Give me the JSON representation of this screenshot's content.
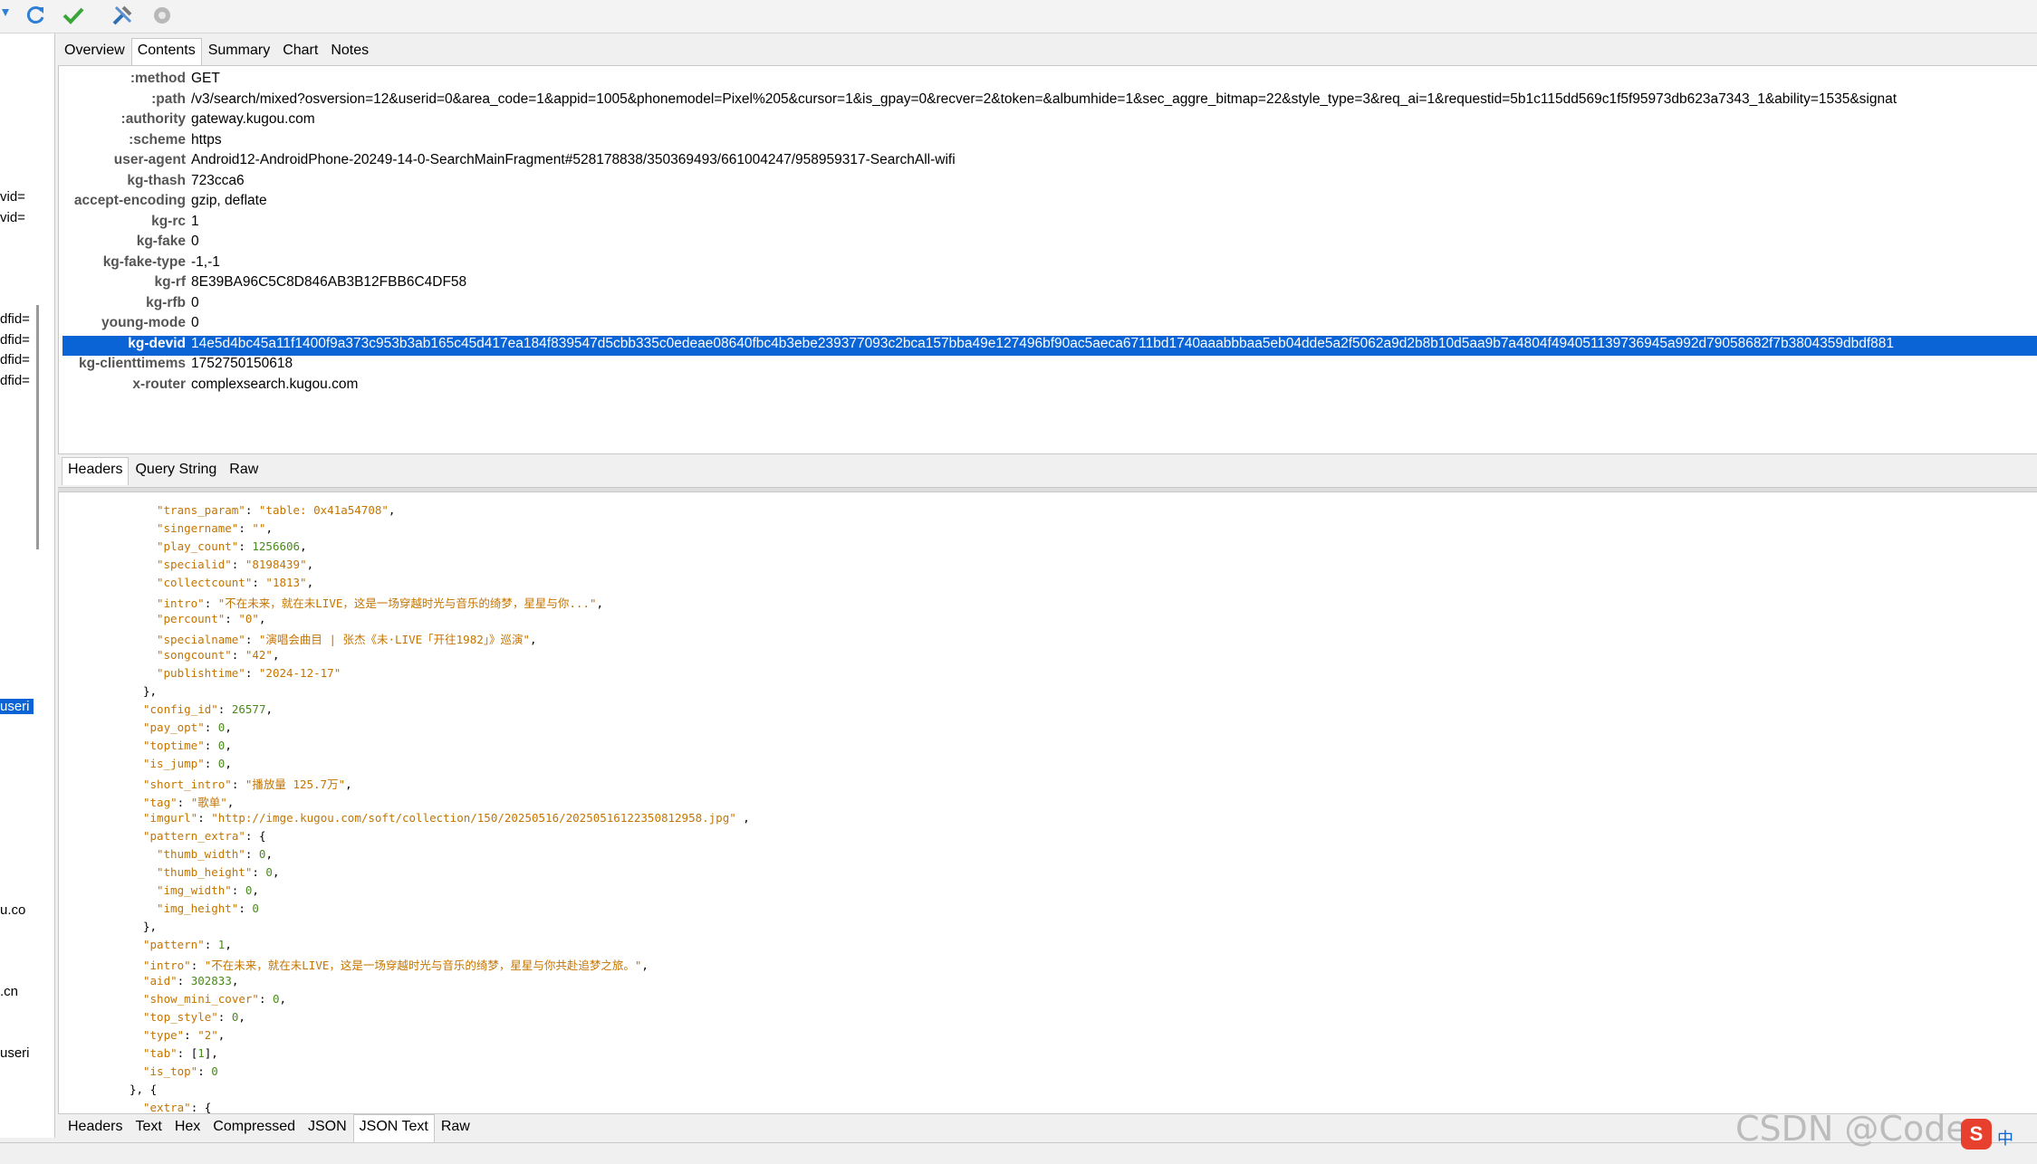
{
  "window": {
    "top_tabs": [
      "Overview",
      "Contents",
      "Summary",
      "Chart",
      "Notes"
    ],
    "active_top_tab": "Contents",
    "mid_tabs": [
      "Headers",
      "Query String",
      "Raw"
    ],
    "bottom_tabs": [
      "Headers",
      "Text",
      "Hex",
      "Compressed",
      "JSON",
      "JSON Text",
      "Raw"
    ]
  },
  "sidebar": {
    "fragments": [
      "vid=",
      "vid=",
      "dfid=",
      "dfid=",
      "dfid=",
      "dfid=",
      "useri",
      "u.co",
      ".cn",
      "useri"
    ]
  },
  "headers": [
    {
      "key": ":method",
      "value": "GET"
    },
    {
      "key": ":path",
      "value": "/v3/search/mixed?osversion=12&userid=0&area_code=1&appid=1005&phonemodel=Pixel%205&cursor=1&is_gpay=0&recver=2&token=&albumhide=1&sec_aggre_bitmap=22&style_type=3&req_ai=1&requestid=5b1c115dd569c1f5f95973db623a7343_1&ability=1535&signat"
    },
    {
      "key": ":authority",
      "value": "gateway.kugou.com"
    },
    {
      "key": ":scheme",
      "value": "https"
    },
    {
      "key": "user-agent",
      "value": "Android12-AndroidPhone-20249-14-0-SearchMainFragment#528178838/350369493/661004247/958959317-SearchAll-wifi"
    },
    {
      "key": "kg-thash",
      "value": "723cca6"
    },
    {
      "key": "accept-encoding",
      "value": "gzip, deflate"
    },
    {
      "key": "kg-rc",
      "value": "1"
    },
    {
      "key": "kg-fake",
      "value": "0"
    },
    {
      "key": "kg-fake-type",
      "value": "-1,-1"
    },
    {
      "key": "kg-rf",
      "value": "8E39BA96C5C8D846AB3B12FBB6C4DF58"
    },
    {
      "key": "kg-rfb",
      "value": "0"
    },
    {
      "key": "young-mode",
      "value": "0"
    },
    {
      "key": "kg-devid",
      "value": "14e5d4bc45a11f1400f9a373c953b3ab165c45d417ea184f839547d5cbb335c0edeae08640fbc4b3ebe239377093c2bca157bba49e127496bf90ac5aeca6711bd1740aaabbbaa5eb04dde5a2f5062a9d2b8b10d5aa9b7a4804f494051139736945a992d79058682f7b3804359dbdf881"
    },
    {
      "key": "kg-clienttimems",
      "value": "1752750150618"
    },
    {
      "key": "x-router",
      "value": "complexsearch.kugou.com"
    }
  ],
  "selected_header": "kg-devid",
  "json_lines": [
    {
      "indent": 4,
      "parts": [
        [
          "k",
          "\"trans_param\""
        ],
        [
          "p",
          ": "
        ],
        [
          "s",
          "\"table: 0x41a54708\""
        ],
        [
          "p",
          ","
        ]
      ]
    },
    {
      "indent": 4,
      "parts": [
        [
          "k",
          "\"singername\""
        ],
        [
          "p",
          ": "
        ],
        [
          "s",
          "\"\""
        ],
        [
          "p",
          ","
        ]
      ]
    },
    {
      "indent": 4,
      "parts": [
        [
          "k",
          "\"play_count\""
        ],
        [
          "p",
          ": "
        ],
        [
          "n",
          "1256606"
        ],
        [
          "p",
          ","
        ]
      ]
    },
    {
      "indent": 4,
      "parts": [
        [
          "k",
          "\"specialid\""
        ],
        [
          "p",
          ": "
        ],
        [
          "s",
          "\"8198439\""
        ],
        [
          "p",
          ","
        ]
      ]
    },
    {
      "indent": 4,
      "parts": [
        [
          "k",
          "\"collectcount\""
        ],
        [
          "p",
          ": "
        ],
        [
          "s",
          "\"1813\""
        ],
        [
          "p",
          ","
        ]
      ]
    },
    {
      "indent": 4,
      "parts": [
        [
          "k",
          "\"intro\""
        ],
        [
          "p",
          ": "
        ],
        [
          "s",
          "\"不在未来，就在未LIVE，这是一场穿越时光与音乐的绮梦，星星与你...\""
        ],
        [
          "p",
          ","
        ]
      ]
    },
    {
      "indent": 4,
      "parts": [
        [
          "k",
          "\"percount\""
        ],
        [
          "p",
          ": "
        ],
        [
          "s",
          "\"0\""
        ],
        [
          "p",
          ","
        ]
      ]
    },
    {
      "indent": 4,
      "parts": [
        [
          "k",
          "\"specialname\""
        ],
        [
          "p",
          ": "
        ],
        [
          "s",
          "\"演唱会曲目 | 张杰《未·LIVE「开往1982」》巡演\""
        ],
        [
          "p",
          ","
        ]
      ]
    },
    {
      "indent": 4,
      "parts": [
        [
          "k",
          "\"songcount\""
        ],
        [
          "p",
          ": "
        ],
        [
          "s",
          "\"42\""
        ],
        [
          "p",
          ","
        ]
      ]
    },
    {
      "indent": 4,
      "parts": [
        [
          "k",
          "\"publishtime\""
        ],
        [
          "p",
          ": "
        ],
        [
          "s",
          "\"2024-12-17\""
        ]
      ]
    },
    {
      "indent": 3,
      "parts": [
        [
          "p",
          "},"
        ]
      ]
    },
    {
      "indent": 3,
      "parts": [
        [
          "k",
          "\"config_id\""
        ],
        [
          "p",
          ": "
        ],
        [
          "n",
          "26577"
        ],
        [
          "p",
          ","
        ]
      ]
    },
    {
      "indent": 3,
      "parts": [
        [
          "k",
          "\"pay_opt\""
        ],
        [
          "p",
          ": "
        ],
        [
          "n",
          "0"
        ],
        [
          "p",
          ","
        ]
      ]
    },
    {
      "indent": 3,
      "parts": [
        [
          "k",
          "\"toptime\""
        ],
        [
          "p",
          ": "
        ],
        [
          "n",
          "0"
        ],
        [
          "p",
          ","
        ]
      ]
    },
    {
      "indent": 3,
      "parts": [
        [
          "k",
          "\"is_jump\""
        ],
        [
          "p",
          ": "
        ],
        [
          "n",
          "0"
        ],
        [
          "p",
          ","
        ]
      ]
    },
    {
      "indent": 3,
      "parts": [
        [
          "k",
          "\"short_intro\""
        ],
        [
          "p",
          ": "
        ],
        [
          "s",
          "\"播放量 125.7万\""
        ],
        [
          "p",
          ","
        ]
      ]
    },
    {
      "indent": 3,
      "parts": [
        [
          "k",
          "\"tag\""
        ],
        [
          "p",
          ": "
        ],
        [
          "s",
          "\"歌单\""
        ],
        [
          "p",
          ","
        ]
      ]
    },
    {
      "indent": 3,
      "parts": [
        [
          "k",
          "\"imgurl\""
        ],
        [
          "p",
          ": "
        ],
        [
          "s",
          "\"http://imge.kugou.com/soft/collection/150/20250516/20250516122350812958.jpg\""
        ],
        [
          "p",
          " ,"
        ]
      ]
    },
    {
      "indent": 3,
      "parts": [
        [
          "k",
          "\"pattern_extra\""
        ],
        [
          "p",
          ": {"
        ]
      ]
    },
    {
      "indent": 4,
      "parts": [
        [
          "k",
          "\"thumb_width\""
        ],
        [
          "p",
          ": "
        ],
        [
          "n",
          "0"
        ],
        [
          "p",
          ","
        ]
      ]
    },
    {
      "indent": 4,
      "parts": [
        [
          "k",
          "\"thumb_height\""
        ],
        [
          "p",
          ": "
        ],
        [
          "n",
          "0"
        ],
        [
          "p",
          ","
        ]
      ]
    },
    {
      "indent": 4,
      "parts": [
        [
          "k",
          "\"img_width\""
        ],
        [
          "p",
          ": "
        ],
        [
          "n",
          "0"
        ],
        [
          "p",
          ","
        ]
      ]
    },
    {
      "indent": 4,
      "parts": [
        [
          "k",
          "\"img_height\""
        ],
        [
          "p",
          ": "
        ],
        [
          "n",
          "0"
        ]
      ]
    },
    {
      "indent": 3,
      "parts": [
        [
          "p",
          "},"
        ]
      ]
    },
    {
      "indent": 3,
      "parts": [
        [
          "k",
          "\"pattern\""
        ],
        [
          "p",
          ": "
        ],
        [
          "n",
          "1"
        ],
        [
          "p",
          ","
        ]
      ]
    },
    {
      "indent": 3,
      "parts": [
        [
          "k",
          "\"intro\""
        ],
        [
          "p",
          ": "
        ],
        [
          "s",
          "\"不在未来，就在未LIVE，这是一场穿越时光与音乐的绮梦，星星与你共赴追梦之旅。\""
        ],
        [
          "p",
          ","
        ]
      ]
    },
    {
      "indent": 3,
      "parts": [
        [
          "k",
          "\"aid\""
        ],
        [
          "p",
          ": "
        ],
        [
          "n",
          "302833"
        ],
        [
          "p",
          ","
        ]
      ]
    },
    {
      "indent": 3,
      "parts": [
        [
          "k",
          "\"show_mini_cover\""
        ],
        [
          "p",
          ": "
        ],
        [
          "n",
          "0"
        ],
        [
          "p",
          ","
        ]
      ]
    },
    {
      "indent": 3,
      "parts": [
        [
          "k",
          "\"top_style\""
        ],
        [
          "p",
          ": "
        ],
        [
          "n",
          "0"
        ],
        [
          "p",
          ","
        ]
      ]
    },
    {
      "indent": 3,
      "parts": [
        [
          "k",
          "\"type\""
        ],
        [
          "p",
          ": "
        ],
        [
          "s",
          "\"2\""
        ],
        [
          "p",
          ","
        ]
      ]
    },
    {
      "indent": 3,
      "parts": [
        [
          "k",
          "\"tab\""
        ],
        [
          "p",
          ": ["
        ],
        [
          "n",
          "1"
        ],
        [
          "p",
          "],"
        ]
      ]
    },
    {
      "indent": 3,
      "parts": [
        [
          "k",
          "\"is_top\""
        ],
        [
          "p",
          ": "
        ],
        [
          "n",
          "0"
        ]
      ]
    },
    {
      "indent": 2,
      "parts": [
        [
          "p",
          "}, {"
        ]
      ]
    },
    {
      "indent": 3,
      "parts": [
        [
          "k",
          "\"extra\""
        ],
        [
          "p",
          ": {"
        ]
      ]
    }
  ],
  "watermark": "CSDN @Code",
  "ime": {
    "logo": "S",
    "lang": "中"
  },
  "colors": {
    "selection": "#0a64d6",
    "json_key": "#c47400",
    "json_number": "#4a8a1c"
  }
}
